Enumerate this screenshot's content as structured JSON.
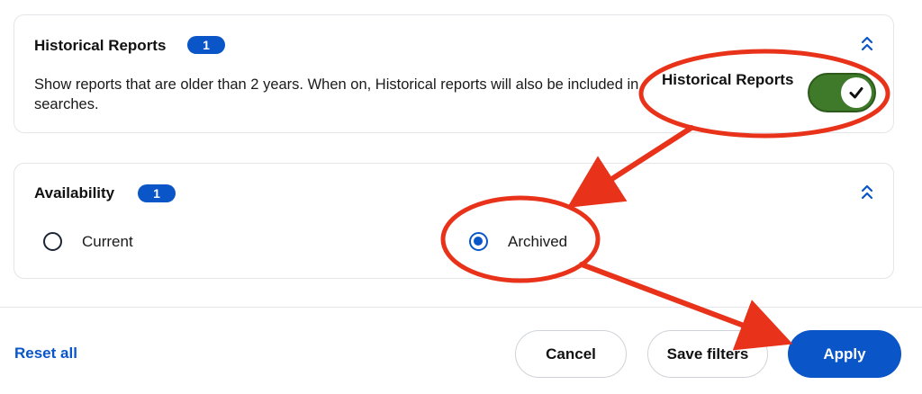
{
  "historical_section": {
    "title": "Historical Reports",
    "badge_count": "1",
    "description": "Show reports that are older than 2 years. When on, Historical reports will also be included in searches.",
    "toggle_label": "Historical Reports",
    "toggle_on": true
  },
  "availability_section": {
    "title": "Availability",
    "badge_count": "1",
    "options": [
      {
        "label": "Current",
        "selected": false
      },
      {
        "label": "Archived",
        "selected": true
      }
    ]
  },
  "footer": {
    "reset_label": "Reset all",
    "cancel_label": "Cancel",
    "save_label": "Save filters",
    "apply_label": "Apply"
  },
  "colors": {
    "accent": "#0a56c8",
    "toggle_on": "#3f7a2a",
    "annotation": "#e8321a",
    "border": "#e3e5e8"
  },
  "icons": {
    "collapse": "chevrons-up-icon",
    "toggle_check": "check-icon"
  }
}
